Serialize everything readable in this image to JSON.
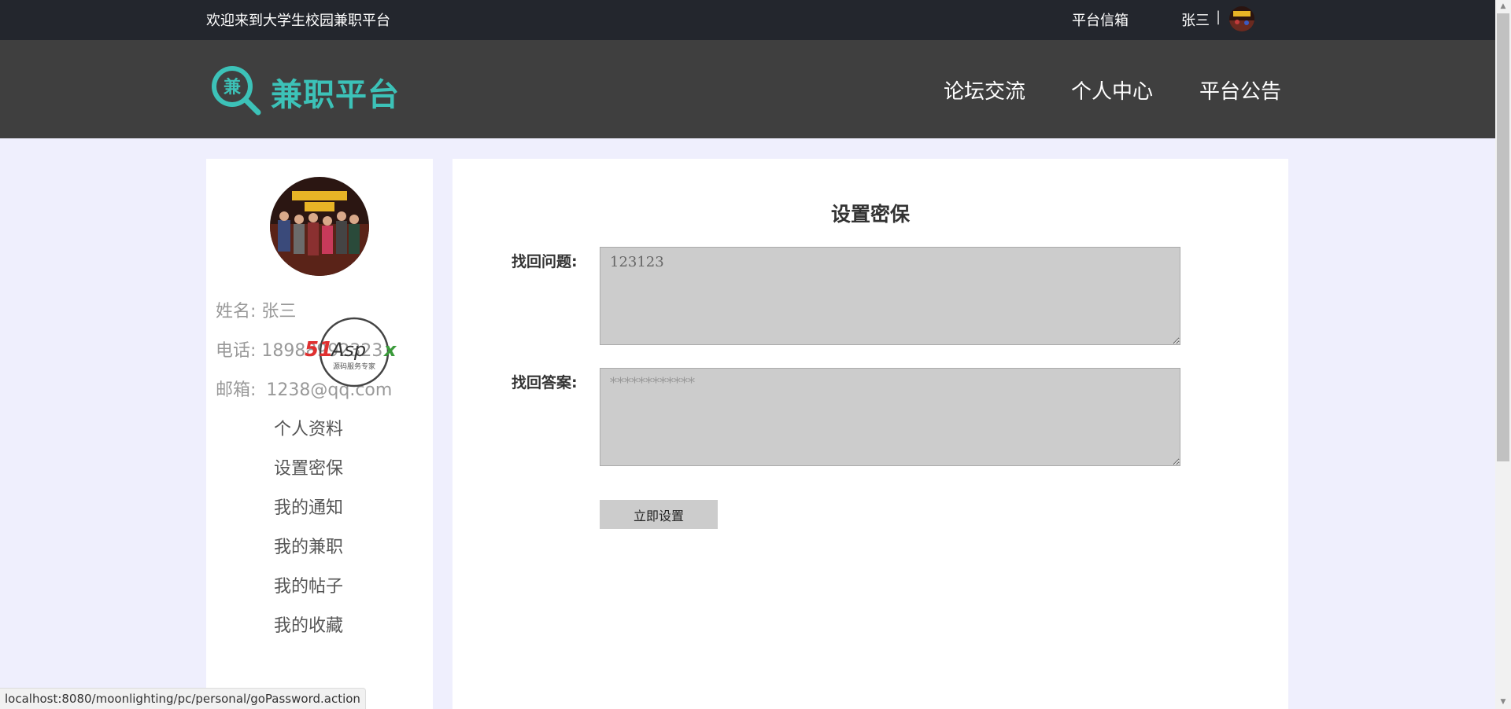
{
  "topbar": {
    "welcome": "欢迎来到大学生校园兼职平台",
    "mailbox": "平台信箱",
    "username": "张三",
    "separator": "|"
  },
  "header": {
    "logo_char": "兼",
    "logo_text": "兼职平台",
    "nav": [
      "论坛交流",
      "个人中心",
      "平台公告"
    ]
  },
  "sidebar": {
    "name_label": "姓名:",
    "name_value": "张三",
    "phone_label": "电话:",
    "phone_value": "18988992323",
    "email_label": "邮箱:",
    "email_value": "1238@qq.com",
    "menu": [
      "个人资料",
      "设置密保",
      "我的通知",
      "我的兼职",
      "我的帖子",
      "我的收藏"
    ]
  },
  "main": {
    "title": "设置密保",
    "question_label": "找回问题:",
    "question_value": "123123",
    "answer_label": "找回答案:",
    "answer_placeholder": "************",
    "submit_label": "立即设置"
  },
  "watermark": {
    "brand": "51Aspx",
    "tagline": "源码服务专家"
  },
  "statusbar": {
    "url": "localhost:8080/moonlighting/pc/personal/goPassword.action"
  },
  "colors": {
    "topbar_bg": "#23262d",
    "header_bg": "#3f3f3f",
    "accent": "#3cc2b8",
    "page_bg": "#efeffd",
    "input_bg": "#cccccc"
  }
}
